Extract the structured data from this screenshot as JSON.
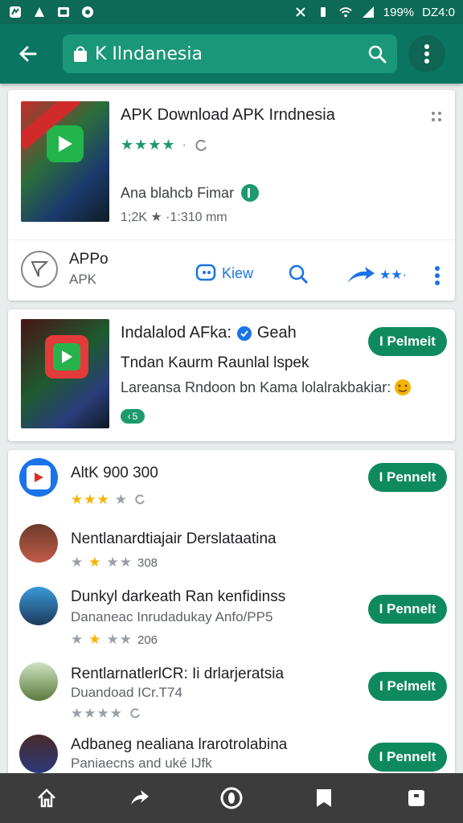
{
  "status": {
    "percent": "199%",
    "time": "DZ4:0"
  },
  "appbar": {
    "query": "K Ilndanesia"
  },
  "featured": {
    "title": "APK Download APK Irndnesia",
    "developer": "Ana blahcb Fimar",
    "meta": "1;2K ★ ·1:310 mm",
    "app_label": "APPo",
    "app_sub": "APK",
    "action_label": "Kiew",
    "accent": "#1a73e8"
  },
  "promo": {
    "title": "Indalalod AFka:",
    "badge_text": "Geah",
    "line1": "Tndan Kaurm Raunlal lspek",
    "line2": "Lareansa Rndoon bn Kama lolalrakbakiar:",
    "chip": "5",
    "install": "I Pelmeit"
  },
  "list": [
    {
      "title": "AltK 900 300",
      "sub": "",
      "stars": "★★★",
      "empty": "★",
      "count": "",
      "install": "I Pennelt",
      "avatar": "app-icon"
    },
    {
      "title": "Nentlanardtiajair Derslataatina",
      "sub": "",
      "stars": "★",
      "empty": "★★",
      "count": "308",
      "install": "",
      "avatar": "person-avatar"
    },
    {
      "title": "Dunkyl darkeath Ran kenfidinss",
      "sub": "Dananeac Inrudadukay Anfo/PP5",
      "stars": "★",
      "empty": "★★",
      "count": "206",
      "install": "I Pennelt",
      "avatar": "person-avatar"
    },
    {
      "title": "RentlarnatlerlCR: Ii drlarjeratsia",
      "sub": "Duandoad ICr.T74",
      "stars": "",
      "empty": "★★★★",
      "count": "",
      "install": "I Pelmelt",
      "avatar": "person-avatar"
    },
    {
      "title": "Adbaneg nealiana lrarotrolabina",
      "sub": "Paniaecns and uké IJfk",
      "stars": "",
      "empty": "",
      "count": "",
      "install": "I Pennelt",
      "avatar": "person-avatar"
    }
  ],
  "colors": {
    "primary": "#0a7662",
    "install": "#0f8a5f",
    "navbar": "#3c3c3c"
  }
}
